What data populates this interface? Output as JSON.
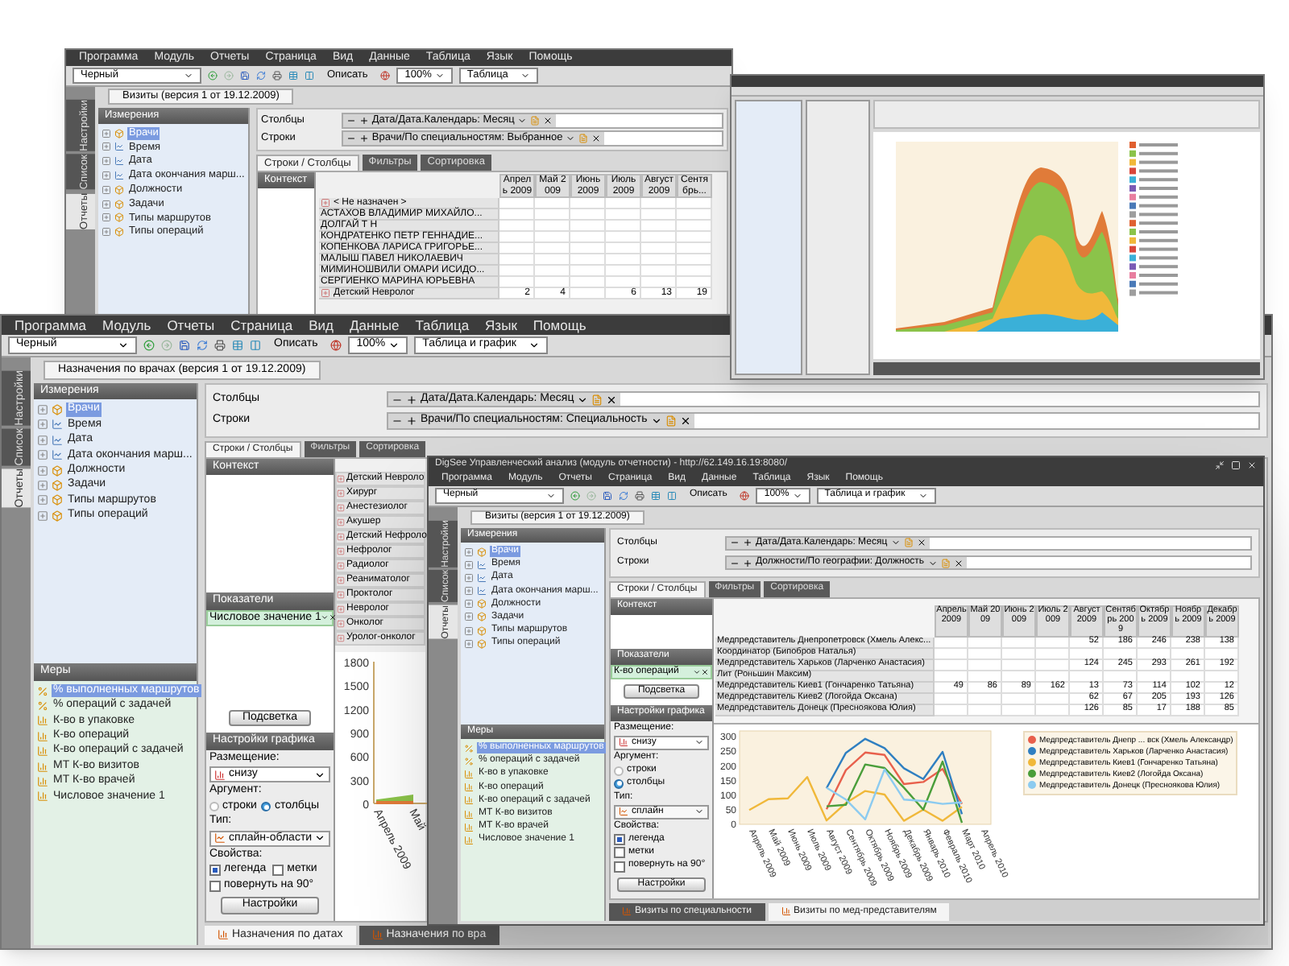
{
  "windows": [
    {
      "kind": "pivot",
      "menu": [
        "Программа",
        "Модуль",
        "Отчеты",
        "Страница",
        "Вид",
        "Данные",
        "Таблица",
        "Язык",
        "Помощь"
      ],
      "toolbar": {
        "scheme": "Черный",
        "describe": "Описать",
        "zoom": "100%",
        "view": "Таблица"
      },
      "side_tabs": [
        {
          "label": "Настройки",
          "selected": false
        },
        {
          "label": "Список",
          "selected": false
        },
        {
          "label": "Отчеты",
          "selected": true
        }
      ],
      "doc_tab": "Визиты (версия 1 от 19.12.2009)",
      "dimensions": {
        "title": "Измерения",
        "items": [
          {
            "label": "Врачи",
            "kind": "dim",
            "selected": true
          },
          {
            "label": "Время",
            "kind": "time",
            "selected": false
          },
          {
            "label": "Дата",
            "kind": "time",
            "selected": false
          },
          {
            "label": "Дата окончания марш...",
            "kind": "time",
            "selected": false
          },
          {
            "label": "Должности",
            "kind": "dim",
            "selected": false
          },
          {
            "label": "Задачи",
            "kind": "dim",
            "selected": false
          },
          {
            "label": "Типы маршрутов",
            "kind": "dim",
            "selected": false
          },
          {
            "label": "Типы операций",
            "kind": "dim",
            "selected": false
          }
        ]
      },
      "filters": [
        {
          "label": "Столбцы",
          "value": "Дата/Дата.Календарь: Месяц"
        },
        {
          "label": "Строки",
          "value": "Врачи/По специальностям: Выбранное"
        }
      ],
      "sub_tabs": [
        {
          "label": "Строки / Столбцы",
          "selected": true
        },
        {
          "label": "Фильтры",
          "selected": false
        },
        {
          "label": "Сортировка",
          "selected": false
        }
      ],
      "context": "Контекст",
      "table": {
        "columns": [
          "Апрель 2009",
          "Май 2009",
          "Июнь 2009",
          "Июль 2009",
          "Август 2009",
          "Сентябрь..."
        ],
        "rows": [
          {
            "label": "< Не назначен >",
            "kind": "group",
            "cells": [
              "",
              "",
              "",
              "",
              "",
              ""
            ]
          },
          {
            "label": "АСТАХОВ ВЛАДИМИР МИХАЙЛО...",
            "kind": "item",
            "cells": [
              "",
              "",
              "",
              "",
              "",
              ""
            ]
          },
          {
            "label": "ДОЛГАЙ Т Н",
            "kind": "item",
            "cells": [
              "",
              "",
              "",
              "",
              "",
              ""
            ]
          },
          {
            "label": "КОНДРАТЕНКО ПЕТР ГЕННАДИЕ...",
            "kind": "item",
            "cells": [
              "",
              "",
              "",
              "",
              "",
              ""
            ]
          },
          {
            "label": "КОПЕНКОВА ЛАРИСА ГРИГОРЬЕ...",
            "kind": "item",
            "cells": [
              "",
              "",
              "",
              "",
              "",
              ""
            ]
          },
          {
            "label": "МАЛЫШ ПАВЕЛ НИКОЛАЕВИЧ",
            "kind": "item",
            "cells": [
              "",
              "",
              "",
              "",
              "",
              ""
            ]
          },
          {
            "label": "МИМИНОШВИЛИ ОМАРИ ИСИДО...",
            "kind": "item",
            "cells": [
              "",
              "",
              "",
              "",
              "",
              ""
            ]
          },
          {
            "label": "СЕРГИЕНКО МАРИНА ЮРЬЕВНА",
            "kind": "item",
            "cells": [
              "",
              "",
              "",
              "",
              "",
              ""
            ]
          },
          {
            "label": "Детский Невролог",
            "kind": "group",
            "cells": [
              "2",
              "4",
              "",
              "6",
              "13",
              "19"
            ]
          }
        ]
      }
    },
    {
      "kind": "chart",
      "menu": [
        "Программа",
        "Модуль",
        "Отчеты",
        "Страница",
        "Вид",
        "Данные",
        "Таблица",
        "Язык",
        "Помощь"
      ],
      "toolbar": {
        "scheme": "Черный",
        "describe": "Описать",
        "zoom": "100%",
        "view": "Таблица и график"
      },
      "side_tabs": [
        {
          "label": "Настройки",
          "selected": false
        },
        {
          "label": "Список",
          "selected": false
        },
        {
          "label": "Отчеты",
          "selected": true
        }
      ],
      "doc_tab": "Назначения по врачах (версия 1 от 19.12.2009)",
      "dimensions": {
        "title": "Измерения",
        "items": [
          {
            "label": "Врачи",
            "kind": "dim",
            "selected": true
          },
          {
            "label": "Время",
            "kind": "time",
            "selected": false
          },
          {
            "label": "Дата",
            "kind": "time",
            "selected": false
          },
          {
            "label": "Дата окончания марш...",
            "kind": "time",
            "selected": false
          },
          {
            "label": "Должности",
            "kind": "dim",
            "selected": false
          },
          {
            "label": "Задачи",
            "kind": "dim",
            "selected": false
          },
          {
            "label": "Типы маршрутов",
            "kind": "dim",
            "selected": false
          },
          {
            "label": "Типы операций",
            "kind": "dim",
            "selected": false
          }
        ]
      },
      "measures": {
        "title": "Меры",
        "items": [
          {
            "label": "% выполненных маршрутов",
            "kind": "percent",
            "selected": true
          },
          {
            "label": "% операций с задачей",
            "kind": "percent",
            "selected": false
          },
          {
            "label": "К-во в упаковке",
            "kind": "count",
            "selected": false
          },
          {
            "label": "К-во операций",
            "kind": "count",
            "selected": false
          },
          {
            "label": "К-во операций с задачей",
            "kind": "count",
            "selected": false
          },
          {
            "label": "МТ К-во визитов",
            "kind": "count",
            "selected": false
          },
          {
            "label": "МТ К-во врачей",
            "kind": "count",
            "selected": false
          },
          {
            "label": "Числовое значение 1",
            "kind": "count",
            "selected": false
          }
        ]
      },
      "filters": [
        {
          "label": "Столбцы",
          "value": "Дата/Дата.Календарь: Месяц"
        },
        {
          "label": "Строки",
          "value": "Врачи/По специальностям: Специальность"
        }
      ],
      "sub_tabs": [
        {
          "label": "Строки / Столбцы",
          "selected": true
        },
        {
          "label": "Фильтры",
          "selected": false
        },
        {
          "label": "Сортировка",
          "selected": false
        }
      ],
      "context": "Контекст",
      "indicators": {
        "title": "Показатели",
        "items": [
          "Числовое значение 1"
        ]
      },
      "highlight_button": "Подсветка",
      "chart_settings": {
        "title": "Настройки графика",
        "placement_label": "Размещение:",
        "placement": "снизу",
        "argument_label": "Аргумент:",
        "argument": [
          {
            "label": "строки",
            "selected": false
          },
          {
            "label": "столбцы",
            "selected": true
          }
        ],
        "type_label": "Тип:",
        "type": "сплайн-области",
        "props_label": "Свойства:",
        "props": [
          {
            "label": "легенда",
            "checked": true
          },
          {
            "label": "метки",
            "checked": false
          },
          {
            "label": "повернуть на 90°",
            "checked": false
          }
        ],
        "button": "Настройки"
      },
      "spec_list": [
        "Детский Невроло",
        "Хирург",
        "Анестезиолог",
        "Акушер",
        "Детский Нефроло",
        "Нефролог",
        "Радиолог",
        "Реаниматолог",
        "Проктолог",
        "Невролог",
        "Онколог",
        "Уролог-онколог"
      ],
      "chart_data": {
        "type": "area",
        "categories": [
          "Апрель 2009",
          "Май"
        ],
        "yticks": [
          0,
          300,
          600,
          900,
          1200,
          1500,
          1800
        ],
        "ylim": [
          0,
          1800
        ],
        "series": [
          {
            "color": "#8bc34a",
            "values": [
              40,
              100
            ]
          },
          {
            "color": "#e07b39",
            "values": [
              20,
              20
            ]
          }
        ]
      },
      "bottom_tabs": [
        {
          "label": "Назначения по датах",
          "selected": true
        },
        {
          "label": "Назначения по вра",
          "selected": false
        }
      ]
    },
    {
      "kind": "table-chart",
      "title": "DigSee Управленческий анализ (модуль отчетности) - http://62.149.16.19:8080/",
      "menu": [
        "Программа",
        "Модуль",
        "Отчеты",
        "Страница",
        "Вид",
        "Данные",
        "Таблица",
        "Язык",
        "Помощь"
      ],
      "toolbar": {
        "scheme": "Черный",
        "describe": "Описать",
        "zoom": "100%",
        "view": "Таблица и график"
      },
      "side_tabs": [
        {
          "label": "Настройки",
          "selected": false
        },
        {
          "label": "Список",
          "selected": false
        },
        {
          "label": "Отчеты",
          "selected": true
        }
      ],
      "doc_tab": "Визиты (версия 1 от 19.12.2009)",
      "dimensions": {
        "title": "Измерения",
        "items": [
          {
            "label": "Врачи",
            "kind": "dim",
            "selected": true
          },
          {
            "label": "Время",
            "kind": "time",
            "selected": false
          },
          {
            "label": "Дата",
            "kind": "time",
            "selected": false
          },
          {
            "label": "Дата окончания марш...",
            "kind": "time",
            "selected": false
          },
          {
            "label": "Должности",
            "kind": "dim",
            "selected": false
          },
          {
            "label": "Задачи",
            "kind": "dim",
            "selected": false
          },
          {
            "label": "Типы маршрутов",
            "kind": "dim",
            "selected": false
          },
          {
            "label": "Типы операций",
            "kind": "dim",
            "selected": false
          }
        ]
      },
      "measures": {
        "title": "Меры",
        "items": [
          {
            "label": "% выполненных маршрутов",
            "kind": "percent",
            "selected": true
          },
          {
            "label": "% операций с задачей",
            "kind": "percent",
            "selected": false
          },
          {
            "label": "К-во в упаковке",
            "kind": "count",
            "selected": false
          },
          {
            "label": "К-во операций",
            "kind": "count",
            "selected": false
          },
          {
            "label": "К-во операций с задачей",
            "kind": "count",
            "selected": false
          },
          {
            "label": "МТ К-во визитов",
            "kind": "count",
            "selected": false
          },
          {
            "label": "МТ К-во врачей",
            "kind": "count",
            "selected": false
          },
          {
            "label": "Числовое значение 1",
            "kind": "count",
            "selected": false
          }
        ]
      },
      "filters": [
        {
          "label": "Столбцы",
          "value": "Дата/Дата.Календарь: Месяц"
        },
        {
          "label": "Строки",
          "value": "Должности/По географии: Должность"
        }
      ],
      "sub_tabs": [
        {
          "label": "Строки / Столбцы",
          "selected": true
        },
        {
          "label": "Фильтры",
          "selected": false
        },
        {
          "label": "Сортировка",
          "selected": false
        }
      ],
      "context": "Контекст",
      "indicators": {
        "title": "Показатели",
        "items": [
          "К-во операций"
        ]
      },
      "highlight_button": "Подсветка",
      "chart_settings": {
        "title": "Настройки графика",
        "placement_label": "Размещение:",
        "placement": "снизу",
        "argument_label": "Аргумент:",
        "argument": [
          {
            "label": "строки",
            "selected": false
          },
          {
            "label": "столбцы",
            "selected": true
          }
        ],
        "type_label": "Тип:",
        "type": "сплайн",
        "props_label": "Свойства:",
        "props": [
          {
            "label": "легенда",
            "checked": true
          },
          {
            "label": "метки",
            "checked": false
          },
          {
            "label": "повернуть на 90°",
            "checked": false
          }
        ],
        "button": "Настройки"
      },
      "table": {
        "columns": [
          "Апрель 2009",
          "Май 2009",
          "Июнь 2009",
          "Июль 2009",
          "Август 2009",
          "Сентябрь 2009",
          "Октябрь 2009",
          "Ноябрь 2009",
          "Декабрь 2009"
        ],
        "rows": [
          {
            "label": "Медпредставитель Днепропетровск (Хмель Алекс...",
            "kind": "item",
            "cells": [
              "",
              "",
              "",
              "",
              "52",
              "186",
              "246",
              "238",
              "138"
            ]
          },
          {
            "label": "Координатор (Бипобров Наталья)",
            "kind": "item",
            "cells": [
              "",
              "",
              "",
              "",
              "",
              "",
              "",
              "",
              ""
            ]
          },
          {
            "label": "Медпредставитель Харьков (Ларченко Анастасия)",
            "kind": "item",
            "cells": [
              "",
              "",
              "",
              "",
              "124",
              "245",
              "293",
              "261",
              "192"
            ]
          },
          {
            "label": "Лит (Роньшин Максим)",
            "kind": "item",
            "cells": [
              "",
              "",
              "",
              "",
              "",
              "",
              "",
              "",
              ""
            ]
          },
          {
            "label": "Медпредставитель Киев1 (Гончаренко Татьяна)",
            "kind": "item",
            "cells": [
              "49",
              "86",
              "89",
              "162",
              "13",
              "73",
              "114",
              "102",
              "12"
            ]
          },
          {
            "label": "Медпредставитель Киев2 (Логойда Оксана)",
            "kind": "item",
            "cells": [
              "",
              "",
              "",
              "",
              "62",
              "67",
              "205",
              "193",
              "126"
            ]
          },
          {
            "label": "Медпредставитель Донецк (Пресноякова Юлия)",
            "kind": "item",
            "cells": [
              "",
              "",
              "",
              "",
              "126",
              "85",
              "17",
              "188",
              "85"
            ]
          }
        ]
      },
      "chart_data": {
        "type": "line",
        "legend": "right",
        "categories": [
          "Апрель 2009",
          "Май 2009",
          "Июнь 2009",
          "Июль 2009",
          "Август 2009",
          "Сентябрь 2009",
          "Октябрь 2009",
          "Ноябрь 2009",
          "Декабрь 2009",
          "Январь 2010",
          "Февраль 2010",
          "Март 2010",
          "Апрель 2010"
        ],
        "yticks": [
          0,
          50,
          100,
          150,
          200,
          250,
          300
        ],
        "ylim": [
          0,
          320
        ],
        "series": [
          {
            "name": "Медпредставитель Днепр ... вск (Хмель Александр)",
            "color": "#e8604c",
            "values": [
              null,
              null,
              null,
              null,
              52,
              186,
              246,
              238,
              138,
              145,
              190,
              70,
              null
            ]
          },
          {
            "name": "Медпредставитель Харьков (Ларченко Анастасия)",
            "color": "#2f7fc1",
            "values": [
              null,
              null,
              null,
              null,
              124,
              245,
              293,
              261,
              192,
              155,
              248,
              35,
              null
            ]
          },
          {
            "name": "Медпредставитель Киев1 (Гончаренко Татьяна)",
            "color": "#f0b83a",
            "values": [
              49,
              86,
              89,
              162,
              13,
              73,
              114,
              102,
              12,
              50,
              12,
              60,
              null
            ]
          },
          {
            "name": "Медпредставитель Киев2 (Логойда Оксана)",
            "color": "#4a9e3a",
            "values": [
              null,
              null,
              null,
              null,
              62,
              67,
              205,
              193,
              126,
              50,
              215,
              5,
              null
            ]
          },
          {
            "name": "Медпредставитель Донецк (Пресноякова Юлия)",
            "color": "#8ccbf0",
            "values": [
              null,
              null,
              null,
              null,
              126,
              85,
              17,
              188,
              85,
              80,
              70,
              75,
              null
            ]
          }
        ]
      },
      "bottom_tabs": [
        {
          "label": "Визиты по специальности",
          "selected": false
        },
        {
          "label": "Визиты по мед-представителям",
          "selected": true
        }
      ]
    }
  ]
}
